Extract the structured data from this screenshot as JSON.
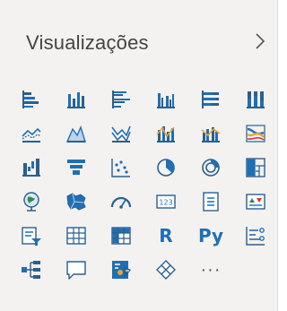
{
  "pane": {
    "title": "Visualizações",
    "collapse_icon": "chevron-right-icon"
  },
  "colors": {
    "background": "#f3f2f1",
    "primary": "#1f6fb4",
    "secondary": "#2a5f8f",
    "accent_orange": "#e6a23c",
    "accent_red": "#d13438",
    "text": "#444444"
  },
  "icons": [
    "stacked-bar-chart-icon",
    "stacked-column-chart-icon",
    "clustered-bar-chart-icon",
    "clustered-column-chart-icon",
    "100-stacked-bar-chart-icon",
    "100-stacked-column-chart-icon",
    "line-chart-icon",
    "area-chart-icon",
    "stacked-area-chart-icon",
    "line-and-stacked-column-chart-icon",
    "line-and-clustered-column-chart-icon",
    "ribbon-chart-icon",
    "waterfall-chart-icon",
    "funnel-chart-icon",
    "scatter-chart-icon",
    "pie-chart-icon",
    "donut-chart-icon",
    "treemap-icon",
    "map-icon",
    "filled-map-icon",
    "gauge-icon",
    "card-icon",
    "multi-row-card-icon",
    "kpi-icon",
    "slicer-icon",
    "table-icon",
    "matrix-icon",
    "r-script-visual-icon",
    "python-visual-icon",
    "key-influencers-icon",
    "decomposition-tree-icon",
    "qa-icon",
    "smart-narrative-icon",
    "power-apps-icon",
    "more-visuals-icon"
  ],
  "text_icons": {
    "r_visual": "R",
    "python_visual": "Py",
    "more": "···"
  }
}
